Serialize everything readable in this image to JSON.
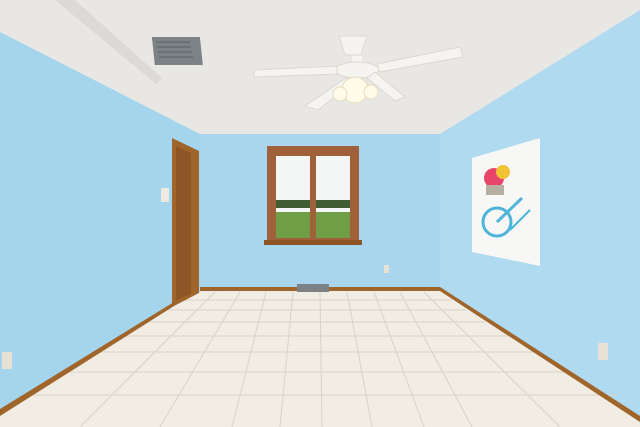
{
  "scene": {
    "description_free": true,
    "colors": {
      "ceiling": "#e9e7e3",
      "ceiling_shadow": "#dcdad6",
      "back_wall": "#a9d6ee",
      "left_wall": "#a5d5ec",
      "right_wall": "#afdaf0",
      "floor": "#f1ece4",
      "floor_grout": "#d9d2c6",
      "trim_wood": "#a0652b",
      "door_wood": "#8e5526",
      "window_frame": "#a0603a",
      "window_sky": "#f4f6f5",
      "window_grass": "#6f9e46",
      "window_trees": "#3f5c33",
      "fan_white": "#f6f4f0",
      "fan_glass": "#fffbe8",
      "vent": "#7d8286",
      "canvas_bg": "#f7f8f6",
      "canvas_bike": "#4fb4d9",
      "canvas_flowers": "#e8456a",
      "outlet": "#e8e2d6"
    },
    "icons": [
      "ceiling-fan-icon",
      "window-icon",
      "door-icon",
      "wall-art-icon",
      "floor-vent-icon",
      "ceiling-vent-icon",
      "outlet-icon"
    ]
  }
}
